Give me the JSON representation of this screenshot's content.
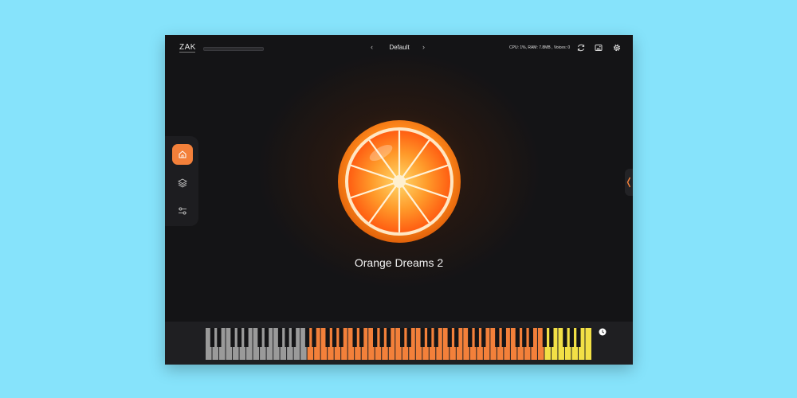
{
  "header": {
    "logo": "ZAK",
    "preset_name": "Default",
    "prev_symbol": "‹",
    "next_symbol": "›",
    "stats": "CPU: 1%, RAM: 7.8MB , Voices: 0"
  },
  "icons": {
    "refresh": "refresh-icon",
    "image": "image-icon",
    "settings": "gear-icon",
    "home": "home-icon",
    "layers": "layers-icon",
    "controls": "sliders-icon",
    "collapse": "chevron-left-icon",
    "keyboard": "clock-icon"
  },
  "main": {
    "title": "Orange Dreams 2"
  },
  "colors": {
    "accent": "#f3803a",
    "background": "#141416",
    "page": "#86e3fb",
    "key_gray": "#9a9a9a",
    "key_orange": "#f3803a",
    "key_yellow": "#f2e046"
  },
  "keyboard": {
    "white_key_count": 57,
    "gray_range": [
      0,
      14
    ],
    "orange_range": [
      15,
      49
    ],
    "yellow_range": [
      50,
      56
    ]
  }
}
